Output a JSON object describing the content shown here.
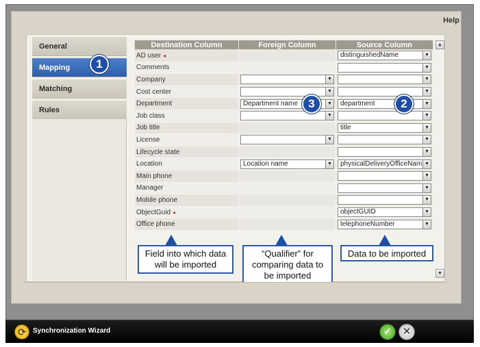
{
  "header": {
    "help_label": "Help"
  },
  "nav": {
    "items": [
      {
        "label": "General"
      },
      {
        "label": "Mapping"
      },
      {
        "label": "Matching"
      },
      {
        "label": "Rules"
      }
    ]
  },
  "badges": {
    "one": "1",
    "two": "2",
    "three": "3"
  },
  "table": {
    "headers": [
      "Destination Column",
      "Foreign Column",
      "Source Column"
    ],
    "rows": [
      {
        "name": "AD user",
        "foreign": "",
        "source": "distinguishedName"
      },
      {
        "name": "Comments",
        "foreign": "",
        "source": ""
      },
      {
        "name": "Company",
        "foreign": "",
        "source": ""
      },
      {
        "name": "Cost center",
        "foreign": "",
        "source": ""
      },
      {
        "name": "Department",
        "foreign": "Department name",
        "source": "department"
      },
      {
        "name": "Job class",
        "foreign": "",
        "source": ""
      },
      {
        "name": "Job title",
        "foreign": "",
        "source": "title"
      },
      {
        "name": "License",
        "foreign": "",
        "source": ""
      },
      {
        "name": "Lifecycle state",
        "foreign": "",
        "source": ""
      },
      {
        "name": "Location",
        "foreign": "Location name",
        "source": "physicalDeliveryOfficeNam"
      },
      {
        "name": "Main phone",
        "foreign": "",
        "source": ""
      },
      {
        "name": "Manager",
        "foreign": "",
        "source": ""
      },
      {
        "name": "Mobile phone",
        "foreign": "",
        "source": ""
      },
      {
        "name": "ObjectGuid",
        "foreign": "",
        "source": "objectGUID"
      },
      {
        "name": "Office phone",
        "foreign": "",
        "source": "telephoneNumber"
      }
    ]
  },
  "callouts": {
    "destination": "Field into which data will be imported",
    "foreign": "“Qualifier” for comparing data to be imported",
    "source": "Data to be imported"
  },
  "footer": {
    "title": "Synchronization Wizard"
  },
  "icons": {
    "required_marker": "◂",
    "dropdown_arrow": "▼",
    "scroll_up": "▲",
    "scroll_down": "▼",
    "ok": "✓",
    "cancel": "✕",
    "wizard": "⟳"
  }
}
